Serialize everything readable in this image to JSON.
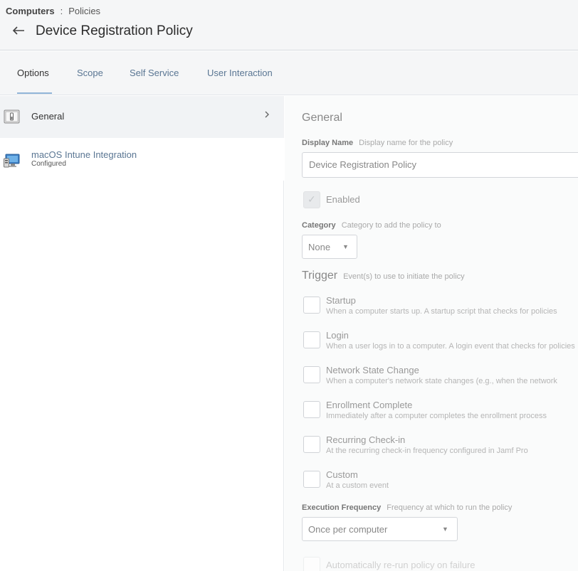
{
  "breadcrumb": {
    "root": "Computers",
    "separator": ":",
    "current": "Policies"
  },
  "header": {
    "title": "Device Registration Policy"
  },
  "tabs": [
    {
      "label": "Options"
    },
    {
      "label": "Scope"
    },
    {
      "label": "Self Service"
    },
    {
      "label": "User Interaction"
    }
  ],
  "sidebar": {
    "items": [
      {
        "label": "General",
        "icon": "general-settings-icon"
      },
      {
        "label": "macOS Intune Integration",
        "sublabel": "Configured",
        "icon": "computer-icon"
      }
    ]
  },
  "general": {
    "section_title": "General",
    "display_name": {
      "label": "Display Name",
      "hint": "Display name for the policy",
      "value": "Device Registration Policy"
    },
    "enabled": {
      "label": "Enabled",
      "checked": true
    },
    "category": {
      "label": "Category",
      "hint": "Category to add the policy to",
      "value": "None"
    }
  },
  "trigger": {
    "title": "Trigger",
    "hint": "Event(s) to use to initiate the policy",
    "options": [
      {
        "label": "Startup",
        "desc": "When a computer starts up. A startup script that checks for policies",
        "checked": false
      },
      {
        "label": "Login",
        "desc": "When a user logs in to a computer. A login event that checks for policies",
        "checked": false
      },
      {
        "label": "Network State Change",
        "desc": "When a computer's network state changes (e.g., when the network",
        "checked": false
      },
      {
        "label": "Enrollment Complete",
        "desc": "Immediately after a computer completes the enrollment process",
        "checked": false
      },
      {
        "label": "Recurring Check-in",
        "desc": "At the recurring check-in frequency configured in Jamf Pro",
        "checked": false
      },
      {
        "label": "Custom",
        "desc": "At a custom event",
        "checked": false
      }
    ]
  },
  "execution_frequency": {
    "label": "Execution Frequency",
    "hint": "Frequency at which to run the policy",
    "value": "Once per computer"
  },
  "rerun": {
    "label": "Automatically re-run policy on failure",
    "checked": false
  }
}
